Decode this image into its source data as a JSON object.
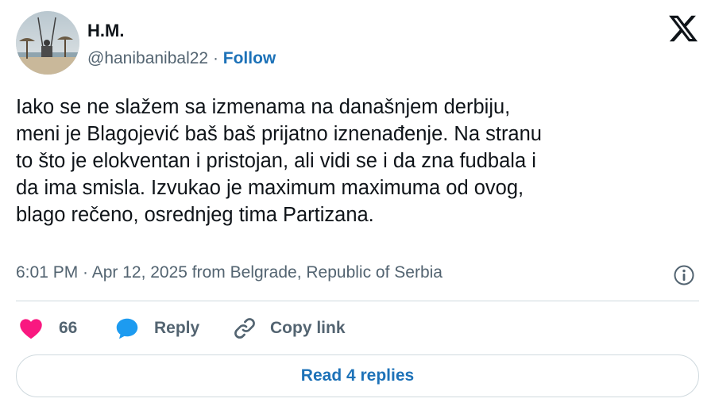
{
  "author": {
    "name": "H.M.",
    "handle": "@hanibanibal22",
    "separator": " · ",
    "follow_label": "Follow"
  },
  "tweet": {
    "lines": [
      "Iako se ne slažem sa izmenama na današnjem derbiju,",
      "meni je Blagojević baš baš prijatno iznenađenje. Na stranu",
      "to što je elokventan i pristojan, ali vidi se i da zna fudbala i",
      "da ima smisla. Izvukao je maximum maximuma od ovog,",
      "blago rečeno, osrednjeg tima Partizana."
    ],
    "timestamp": "6:01 PM · Apr 12, 2025 from Belgrade, Republic of Serbia"
  },
  "actions": {
    "likes_count": "66",
    "reply_label": "Reply",
    "copy_link_label": "Copy link"
  },
  "read_replies_label": "Read 4 replies",
  "icons": {
    "logo": "x-logo-icon",
    "info": "info-icon",
    "like": "heart-icon",
    "reply": "speech-bubble-icon",
    "copy": "link-icon"
  },
  "colors": {
    "like": "#f91880",
    "reply": "#1d9bf0",
    "link": "#1d72b8",
    "muted": "#536471"
  }
}
